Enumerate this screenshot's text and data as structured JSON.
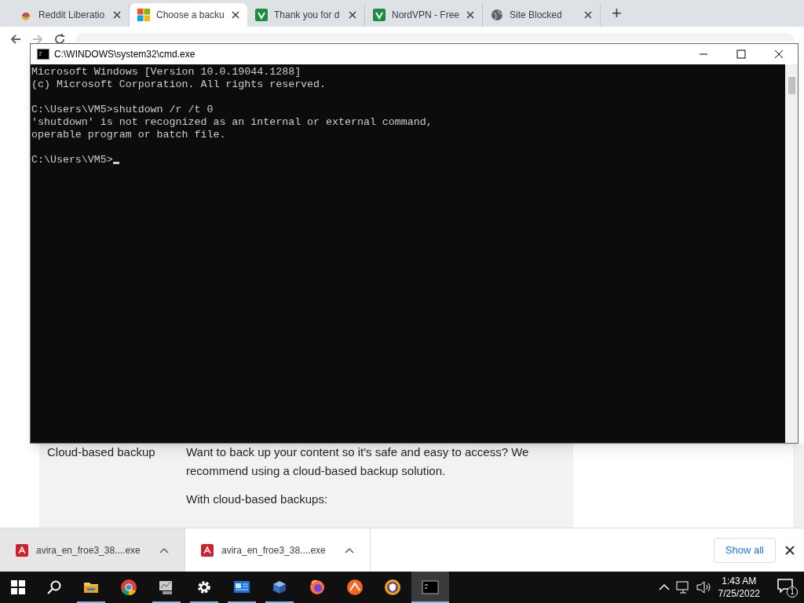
{
  "browser_tabs": [
    {
      "title": "Reddit Liberatio",
      "kind": "reddit",
      "selected": false
    },
    {
      "title": "Choose a backu",
      "kind": "windows",
      "selected": true
    },
    {
      "title": "Thank you for d",
      "kind": "sheet",
      "selected": false
    },
    {
      "title": "NordVPN - Free",
      "kind": "sheet",
      "selected": false
    },
    {
      "title": "Site Blocked",
      "kind": "globe",
      "selected": false
    }
  ],
  "new_tab": "+",
  "page": {
    "row_label": "Cloud-based backup",
    "paragraphs": [
      "Want to back up your content so it's safe and easy to access? We recommend using a cloud-based backup solution.",
      "With cloud-based backups:"
    ]
  },
  "cmd_window": {
    "title": "C:\\WINDOWS\\system32\\cmd.exe",
    "blocks": [
      [
        "Microsoft Windows [Version 10.0.19044.1288]",
        "(c) Microsoft Corporation. All rights reserved."
      ],
      [
        "C:\\Users\\VM5>shutdown /r /t 0",
        "'shutdown' is not recognized as an internal or external command,",
        "operable program or batch file."
      ],
      [
        "C:\\Users\\VM5>"
      ]
    ],
    "cursor": true
  },
  "downloads": [
    {
      "name": "avira_en_froe3_38....exe",
      "selected": true
    },
    {
      "name": "avira_en_froe3_38....exe",
      "selected": false
    }
  ],
  "show_all": "Show all",
  "taskbar": {
    "apps": [
      {
        "kind": "explorer",
        "running": true,
        "selected": false
      },
      {
        "kind": "chrome",
        "running": false,
        "selected": false
      },
      {
        "kind": "monitor",
        "running": true,
        "selected": false
      },
      {
        "kind": "settings",
        "running": true,
        "selected": false
      },
      {
        "kind": "window",
        "running": true,
        "selected": false
      },
      {
        "kind": "box",
        "running": true,
        "selected": false
      },
      {
        "kind": "firefox",
        "running": false,
        "selected": false
      },
      {
        "kind": "orange",
        "running": false,
        "selected": false
      },
      {
        "kind": "shield",
        "running": false,
        "selected": false
      },
      {
        "kind": "console",
        "running": true,
        "selected": true
      }
    ],
    "time": "1:43 AM",
    "date": "7/25/2022",
    "notifications": "1"
  }
}
